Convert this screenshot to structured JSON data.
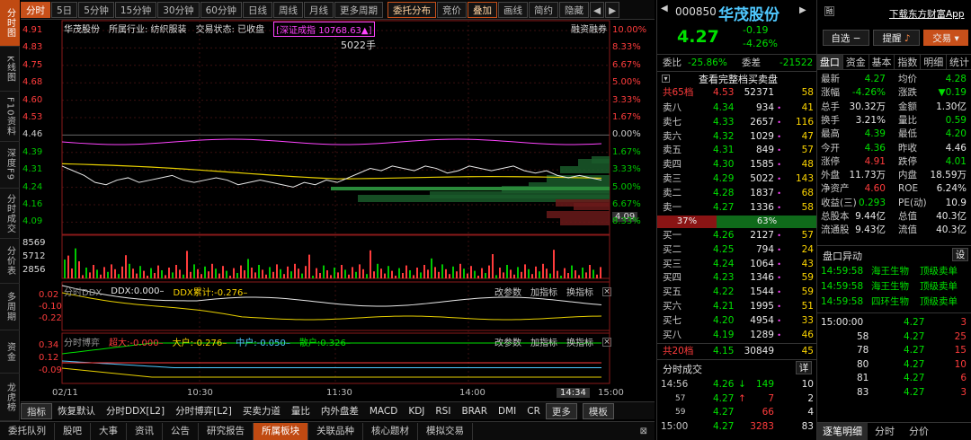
{
  "left_tabs": [
    "分时图",
    "K线图",
    "F10资料",
    "深度F9",
    "分时成交",
    "分价表",
    "多周期",
    "资金",
    "龙虎榜"
  ],
  "toolbar": {
    "items": [
      "分时",
      "5日",
      "5分钟",
      "15分钟",
      "30分钟",
      "60分钟",
      "日线",
      "周线",
      "月线",
      "更多周期",
      "委托分布",
      "竞价",
      "叠加",
      "画线",
      "简约",
      "隐藏"
    ]
  },
  "chart": {
    "stock_name": "华茂股份",
    "industry": "所属行业: 纺织服装",
    "trade_state": "交易状态: 已收盘",
    "index_text": "[深证成指 10768.63▲]",
    "right_tag": "融资融券",
    "mid_label": "5022手",
    "price_ticks": [
      "4.91",
      "4.83",
      "4.75",
      "4.68",
      "4.60",
      "4.53",
      "4.46",
      "4.39",
      "4.31",
      "4.24",
      "4.16",
      "4.09"
    ],
    "pct_ticks": [
      "10.00%",
      "8.33%",
      "6.67%",
      "5.00%",
      "3.33%",
      "1.67%",
      "0.00%",
      "1.67%",
      "3.33%",
      "5.00%",
      "6.67%",
      "8.33%"
    ],
    "price_tag": "4.09",
    "vol_ticks": [
      "8569",
      "5712",
      "2856"
    ],
    "ddx": {
      "title": "分时DDX",
      "ddx": "DDX:0.000–",
      "ddx_sum": "DDX累计:-0.276–",
      "ticks": [
        "0.02",
        "-0.10",
        "-0.22"
      ],
      "btn1": "改参数",
      "btn2": "加指标",
      "btn3": "换指标"
    },
    "game": {
      "title": "分时博弈",
      "super": "超大:-0.000–",
      "big": "大户:-0.276–",
      "mid": "中户:-0.050–",
      "small": "散户:0.326–",
      "ticks": [
        "0.34",
        "0.12",
        "-0.09"
      ],
      "btn1": "改参数",
      "btn2": "加指标",
      "btn3": "换指标"
    },
    "time_ticks": [
      "02/11",
      "10:30",
      "11:30",
      "14:00",
      "15:00"
    ],
    "cursor_time": "14:34"
  },
  "bottom_tabs": [
    "指标",
    "恢复默认",
    "分时DDX[L2]",
    "分时博弈[L2]",
    "买卖力道",
    "量比",
    "内外盘差",
    "MACD",
    "KDJ",
    "RSI",
    "BRAR",
    "DMI",
    "CR",
    "更多",
    "模板"
  ],
  "bottom_tabs2": [
    "委托队列",
    "股吧",
    "大事",
    "资讯",
    "公告",
    "研究报告",
    "所属板块",
    "关联品种",
    "核心题材",
    "模拟交易"
  ],
  "quote": {
    "code": "000850",
    "name": "华茂股份",
    "price": "4.27",
    "change": "-0.19",
    "change_pct": "-4.26%",
    "btn_fav": "自选",
    "btn_alert": "提醒",
    "btn_trade": "交易",
    "weibi_label": "委比",
    "weibi": "-25.86%",
    "weicha_label": "委差",
    "weicha": "-21522",
    "full_book": "查看完整档买卖盘",
    "sell_total": {
      "label": "共65档",
      "price": "4.53",
      "vol": "52371",
      "n": "58"
    },
    "asks": [
      [
        "卖八",
        "4.34",
        "934",
        "41"
      ],
      [
        "卖七",
        "4.33",
        "2657",
        "116"
      ],
      [
        "卖六",
        "4.32",
        "1029",
        "47"
      ],
      [
        "卖五",
        "4.31",
        "849",
        "57"
      ],
      [
        "卖四",
        "4.30",
        "1585",
        "48"
      ],
      [
        "卖三",
        "4.29",
        "5022",
        "143"
      ],
      [
        "卖二",
        "4.28",
        "1837",
        "68"
      ],
      [
        "卖一",
        "4.27",
        "1336",
        "58"
      ]
    ],
    "ratio_left": "37%",
    "ratio_right": "63%",
    "bids": [
      [
        "买一",
        "4.26",
        "2127",
        "57"
      ],
      [
        "买二",
        "4.25",
        "794",
        "24"
      ],
      [
        "买三",
        "4.24",
        "1064",
        "43"
      ],
      [
        "买四",
        "4.23",
        "1346",
        "59"
      ],
      [
        "买五",
        "4.22",
        "1544",
        "59"
      ],
      [
        "买六",
        "4.21",
        "1995",
        "51"
      ],
      [
        "买七",
        "4.20",
        "4954",
        "33"
      ],
      [
        "买八",
        "4.19",
        "1289",
        "46"
      ]
    ],
    "buy_total": {
      "label": "共20档",
      "price": "4.15",
      "vol": "30849",
      "n": "45"
    },
    "ticks_title": "分时成交",
    "ticks_btn": "详",
    "ticks": [
      [
        "14:56",
        "4.26",
        "149",
        "10"
      ],
      [
        "57",
        "4.27",
        "7",
        "2"
      ],
      [
        "59",
        "4.27",
        "66",
        "4"
      ],
      [
        "15:00",
        "4.27",
        "3283",
        "83"
      ]
    ]
  },
  "stats": {
    "app_link": "下载东方财富App",
    "tabs": [
      "盘口",
      "资金",
      "基本",
      "指数",
      "明细",
      "统计"
    ],
    "rows": [
      [
        "最新",
        "4.27",
        "均价",
        "4.28"
      ],
      [
        "涨幅",
        "-4.26%",
        "涨跌",
        "▼0.19"
      ],
      [
        "总手",
        "30.32万",
        "金额",
        "1.30亿"
      ],
      [
        "换手",
        "3.21%",
        "量比",
        "0.59"
      ],
      [
        "最高",
        "4.39",
        "最低",
        "4.20"
      ],
      [
        "今开",
        "4.36",
        "昨收",
        "4.46"
      ],
      [
        "涨停",
        "4.91",
        "跌停",
        "4.01"
      ],
      [
        "外盘",
        "11.73万",
        "内盘",
        "18.59万"
      ],
      [
        "净资产",
        "4.60",
        "ROE",
        "6.24%"
      ],
      [
        "收益(三)",
        "0.293",
        "PE(动)",
        "10.9"
      ],
      [
        "总股本",
        "9.44亿",
        "总值",
        "40.3亿"
      ],
      [
        "流通股",
        "9.43亿",
        "流值",
        "40.3亿"
      ]
    ],
    "alerts_title": "盘口异动",
    "alerts_btn": "设",
    "alerts": [
      [
        "14:59:58",
        "海王生物",
        "顶级卖单"
      ],
      [
        "14:59:58",
        "海王生物",
        "顶级卖单"
      ],
      [
        "14:59:58",
        "四环生物",
        "顶级卖单"
      ]
    ],
    "deals": [
      [
        "15:00:00",
        "4.27",
        "3"
      ],
      [
        "58",
        "4.27",
        "25"
      ],
      [
        "78",
        "4.27",
        "15"
      ],
      [
        "80",
        "4.27",
        "10"
      ],
      [
        "81",
        "4.27",
        "6"
      ],
      [
        "83",
        "4.27",
        "3"
      ]
    ],
    "bottom": [
      "逐笔明细",
      "分时",
      "分价"
    ]
  }
}
